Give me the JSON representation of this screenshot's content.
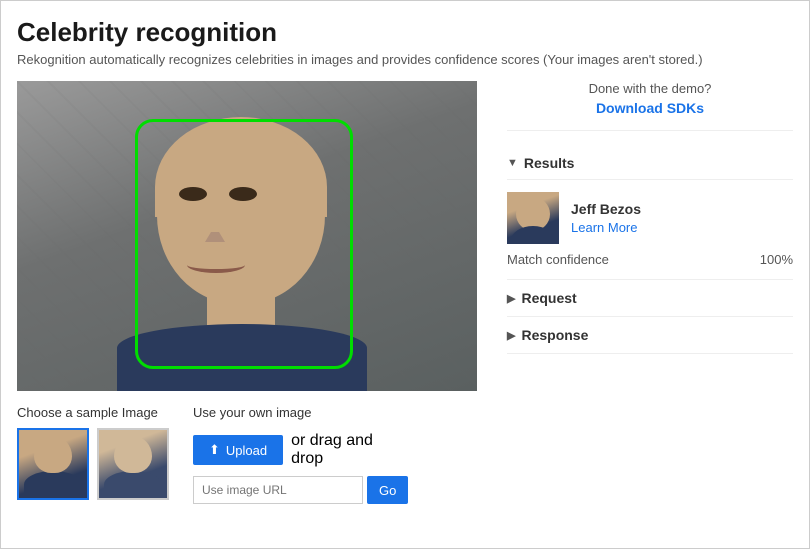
{
  "page": {
    "title": "Celebrity recognition",
    "subtitle": "Rekognition automatically recognizes celebrities in images and provides confidence scores (Your images aren't stored.)"
  },
  "sdk": {
    "done_text": "Done with the demo?",
    "download_label": "Download SDKs"
  },
  "results": {
    "section_label": "Results",
    "celebrity": {
      "name": "Jeff Bezos",
      "learn_more": "Learn More"
    },
    "match_label": "Match confidence",
    "match_value": "100%"
  },
  "request": {
    "section_label": "Request"
  },
  "response": {
    "section_label": "Response"
  },
  "samples": {
    "label": "Choose a sample Image"
  },
  "own_image": {
    "label": "Use your own image",
    "upload_btn": "Upload",
    "or_text": "or drag and",
    "drop_text": "drop",
    "url_placeholder": "Use image URL",
    "go_btn": "Go"
  },
  "icons": {
    "upload": "⬆",
    "arrow_down": "▼",
    "arrow_right": "▶"
  }
}
